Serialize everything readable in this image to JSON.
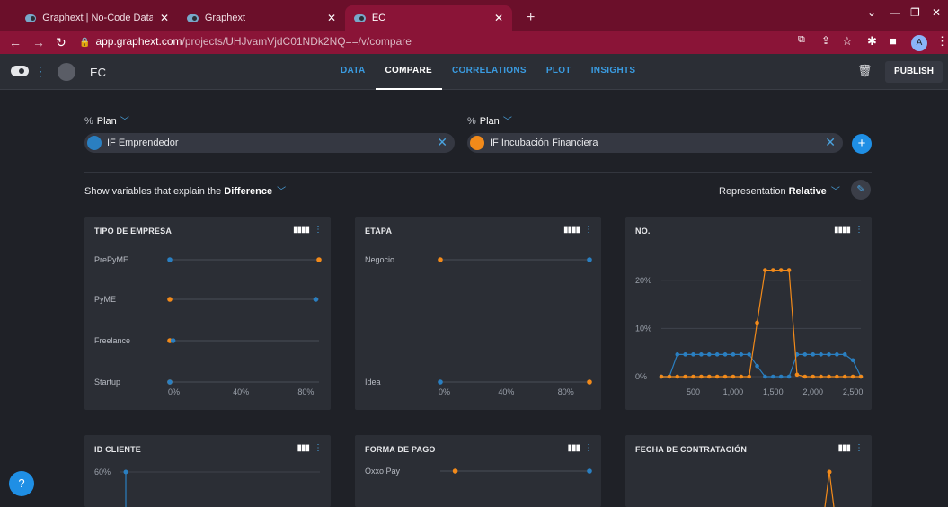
{
  "browser": {
    "tabs": [
      {
        "title": "Graphext | No-Code Data Analyti",
        "active": false
      },
      {
        "title": "Graphext",
        "active": false
      },
      {
        "title": "EC",
        "active": true
      }
    ],
    "new_tab": "+",
    "url_host": "app.graphext.com",
    "url_path": "/projects/UHJvamVjdC01NDk2NQ==/v/compare",
    "profile_initial": "A"
  },
  "app": {
    "project_title": "EC",
    "nav": [
      "DATA",
      "COMPARE",
      "CORRELATIONS",
      "PLOT",
      "INSIGHTS"
    ],
    "active_nav": "COMPARE",
    "publish_label": "PUBLISH"
  },
  "compare": {
    "left": {
      "label": "Plan",
      "value": "IF Emprendedor",
      "color": "#2a7fc1"
    },
    "right": {
      "label": "Plan",
      "value": "IF Incubación Financiera",
      "color": "#f28a1a"
    },
    "explain_prefix": "Show variables that explain the",
    "explain_value": "Difference",
    "representation_label": "Representation",
    "representation_value": "Relative"
  },
  "colors": {
    "blue": "#2a7fc1",
    "orange": "#f28a1a"
  },
  "cards": {
    "tipo": {
      "title": "TIPO DE EMPRESA"
    },
    "etapa": {
      "title": "ETAPA"
    },
    "no": {
      "title": "NO."
    },
    "id_cliente": {
      "title": "ID CLIENTE"
    },
    "forma_pago": {
      "title": "FORMA DE PAGO"
    },
    "fecha": {
      "title": "FECHA DE CONTRATACIÓN"
    }
  },
  "chart_data": [
    {
      "type": "dot",
      "title": "TIPO DE EMPRESA",
      "categories": [
        "PrePyME",
        "PyME",
        "Freelance",
        "Startup"
      ],
      "series": [
        {
          "name": "IF Emprendedor",
          "values": [
            0,
            90,
            2,
            0
          ]
        },
        {
          "name": "IF Incubación Financiera",
          "values": [
            92,
            0,
            0,
            0
          ]
        }
      ],
      "xticks": [
        "0%",
        "40%",
        "80%"
      ],
      "xlim": [
        0,
        92
      ]
    },
    {
      "type": "dot",
      "title": "ETAPA",
      "categories": [
        "Negocio",
        "Idea"
      ],
      "series": [
        {
          "name": "IF Emprendedor",
          "values": [
            100,
            0
          ]
        },
        {
          "name": "IF Incubación Financiera",
          "values": [
            0,
            100
          ]
        }
      ],
      "xticks": [
        "0%",
        "40%",
        "80%"
      ],
      "xlim": [
        0,
        100
      ]
    },
    {
      "type": "line",
      "title": "NO.",
      "x": [
        100,
        200,
        300,
        400,
        500,
        600,
        700,
        800,
        900,
        1000,
        1100,
        1200,
        1300,
        1400,
        1500,
        1600,
        1700,
        1800,
        1900,
        2000,
        2100,
        2200,
        2300,
        2400,
        2500,
        2600
      ],
      "series": [
        {
          "name": "IF Emprendedor",
          "values": [
            0,
            0,
            4.6,
            4.6,
            4.6,
            4.6,
            4.6,
            4.6,
            4.6,
            4.6,
            4.6,
            4.6,
            2.2,
            0,
            0,
            0,
            0,
            4.6,
            4.6,
            4.6,
            4.6,
            4.6,
            4.6,
            4.6,
            3.4,
            0
          ]
        },
        {
          "name": "IF Incubación Financiera",
          "values": [
            0,
            0,
            0,
            0,
            0,
            0,
            0,
            0,
            0,
            0,
            0,
            0,
            11.2,
            22.1,
            22.1,
            22.1,
            22.1,
            0.4,
            0,
            0,
            0,
            0,
            0,
            0,
            0,
            0
          ]
        }
      ],
      "xticks": [
        "500",
        "1,000",
        "1,500",
        "2,000",
        "2,500"
      ],
      "yticks": [
        "0%",
        "10%",
        "20%"
      ],
      "ylim": [
        0,
        25
      ]
    },
    {
      "type": "line",
      "title": "ID CLIENTE",
      "yticks": [
        "60%"
      ]
    },
    {
      "type": "dot",
      "title": "FORMA DE PAGO",
      "categories": [
        "Oxxo Pay"
      ],
      "series": [
        {
          "name": "IF Emprendedor",
          "values": [
            100
          ]
        },
        {
          "name": "IF Incubación Financiera",
          "values": [
            10
          ]
        }
      ]
    },
    {
      "type": "line",
      "title": "FECHA DE CONTRATACIÓN"
    }
  ]
}
